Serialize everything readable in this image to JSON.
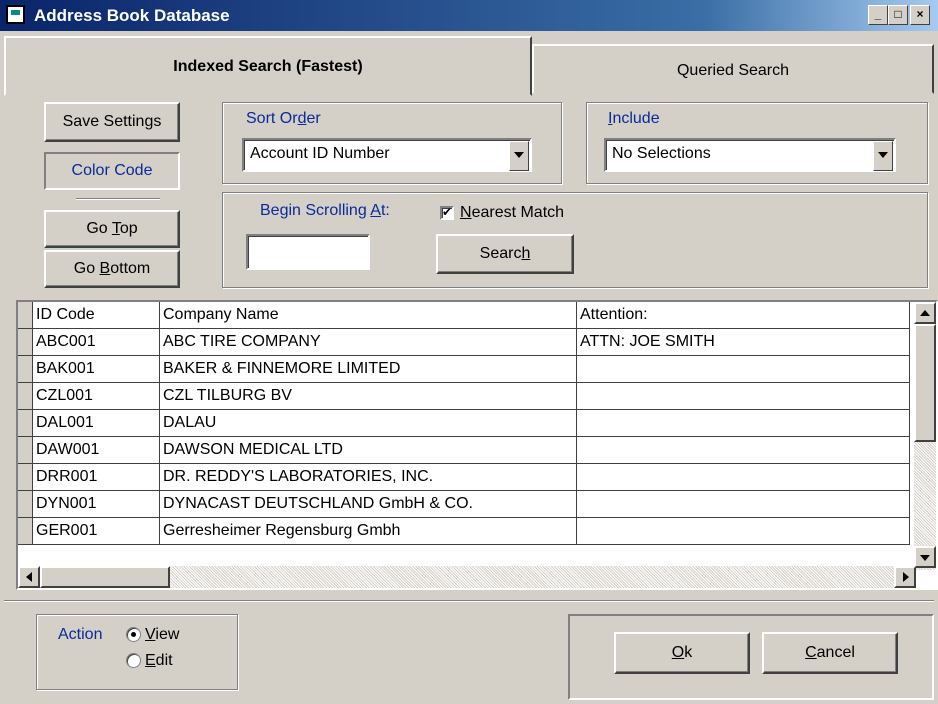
{
  "window": {
    "title": "Address Book Database",
    "minimize": "_",
    "maximize": "□",
    "close": "×"
  },
  "tabs": [
    {
      "label": "Indexed Search (Fastest)"
    },
    {
      "label": "Queried Search"
    }
  ],
  "left_buttons": {
    "save": "Save Settings",
    "color_code": "Color Code",
    "go_top_pre": "Go ",
    "go_top_u": "T",
    "go_top_post": "op",
    "go_bottom_pre": "Go ",
    "go_bottom_u": "B",
    "go_bottom_post": "ottom"
  },
  "sort_order": {
    "label_pre": "Sort Or",
    "label_u": "d",
    "label_post": "er",
    "value": "Account ID Number"
  },
  "include": {
    "label_u": "I",
    "label_post": "nclude",
    "value": "No Selections"
  },
  "scroll": {
    "label_pre": "Begin Scrolling ",
    "label_u": "A",
    "label_post": "t:",
    "input_value": ""
  },
  "nearest_match": {
    "u": "N",
    "post": "earest Match",
    "checked": true
  },
  "search_button": {
    "pre": "Searc",
    "u": "h"
  },
  "grid": {
    "columns": [
      "ID Code",
      "Company Name",
      "Attention:"
    ],
    "rows": [
      [
        "ABC001",
        "ABC TIRE COMPANY",
        "ATTN: JOE SMITH"
      ],
      [
        "BAK001",
        "BAKER & FINNEMORE LIMITED",
        ""
      ],
      [
        "CZL001",
        "CZL TILBURG BV",
        ""
      ],
      [
        "DAL001",
        "DALAU",
        ""
      ],
      [
        "DAW001",
        "DAWSON MEDICAL  LTD",
        ""
      ],
      [
        "DRR001",
        "DR. REDDY'S LABORATORIES, INC.",
        ""
      ],
      [
        "DYN001",
        "DYNACAST DEUTSCHLAND GmbH & CO.",
        ""
      ],
      [
        "GER001",
        "Gerresheimer Regensburg Gmbh",
        ""
      ]
    ]
  },
  "action": {
    "label": "Action",
    "view_u": "V",
    "view_post": "iew",
    "edit_u": "E",
    "edit_post": "dit",
    "selected": "View"
  },
  "footer": {
    "ok_u": "O",
    "ok_post": "k",
    "cancel_u": "C",
    "cancel_post": "ancel"
  }
}
